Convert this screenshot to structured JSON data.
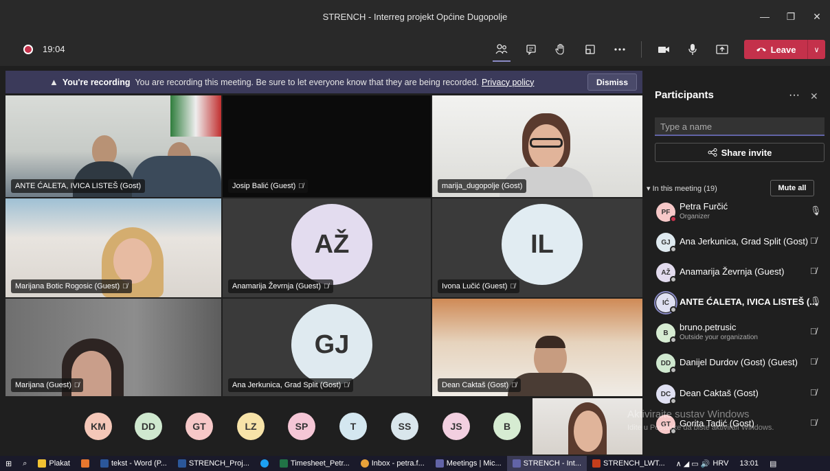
{
  "window": {
    "title": "STRENCH - Interreg projekt Općine Dugopolje",
    "min": "—",
    "max": "❐",
    "close": "✕"
  },
  "toolbar": {
    "timer": "19:04",
    "leave_label": "Leave"
  },
  "banner": {
    "title": "You're recording",
    "text": "You are recording this meeting. Be sure to let everyone know that they are being recorded.",
    "policy": "Privacy policy",
    "dismiss": "Dismiss"
  },
  "tiles": [
    {
      "name": "ANTE ĆALETA, IVICA LISTEŠ (Gost)",
      "muted": false
    },
    {
      "name": "Josip Balić (Guest)",
      "muted": true
    },
    {
      "name": "marija_dugopolje (Gost)",
      "muted": false
    },
    {
      "name": "Marijana Botic Rogosic (Guest)",
      "muted": true
    },
    {
      "name": "Anamarija Ževrnja (Guest)",
      "muted": true,
      "initials": "AŽ",
      "color": "#e3dcef"
    },
    {
      "name": "Ivona Lučić (Guest)",
      "muted": true,
      "initials": "IL",
      "color": "#e1ecf2"
    },
    {
      "name": "Marijana (Guest)",
      "muted": true
    },
    {
      "name": "Ana Jerkunica, Grad Split (Gost)",
      "muted": true,
      "initials": "GJ",
      "color": "#dfeaf0"
    },
    {
      "name": "Dean Caktaš (Gost)",
      "muted": true
    }
  ],
  "gallery": [
    {
      "initials": "KM",
      "color": "#f4c7b8"
    },
    {
      "initials": "DD",
      "color": "#cfe8cf"
    },
    {
      "initials": "GT",
      "color": "#f6c8c8"
    },
    {
      "initials": "LZ",
      "color": "#f7e3a8"
    },
    {
      "initials": "SP",
      "color": "#f5c6d6"
    },
    {
      "initials": "T",
      "color": "#d4e7f0"
    },
    {
      "initials": "SS",
      "color": "#d9e6ec"
    },
    {
      "initials": "JS",
      "color": "#f2cfe0"
    },
    {
      "initials": "B",
      "color": "#d6ecd2"
    }
  ],
  "panel": {
    "title": "Participants",
    "more": "···",
    "close": "✕",
    "search_placeholder": "Type a name",
    "share": "Share invite",
    "meeting_header": "In this meeting (19)",
    "mute_all": "Mute all",
    "participants": [
      {
        "initials": "PF",
        "name": "Petra Furčić",
        "sub": "Organizer",
        "color": "#f6c8c8",
        "mic": "on"
      },
      {
        "initials": "GJ",
        "name": "Ana Jerkunica, Grad Split (Gost)",
        "sub": "",
        "color": "#dfeaf0",
        "mic": "muted"
      },
      {
        "initials": "AŽ",
        "name": "Anamarija Ževrnja (Guest)",
        "sub": "",
        "color": "#e3dcef",
        "mic": "muted"
      },
      {
        "initials": "IĆ",
        "name": "ANTE ĆALETA, IVICA LISTEŠ (...",
        "sub": "",
        "color": "#dfe0f2",
        "mic": "on"
      },
      {
        "initials": "B",
        "name": "bruno.petrusic",
        "sub": "Outside your organization",
        "color": "#d6ecd2",
        "mic": "muted"
      },
      {
        "initials": "DD",
        "name": "Danijel Durdov (Gost) (Guest)",
        "sub": "",
        "color": "#cfe8cf",
        "mic": "muted"
      },
      {
        "initials": "DC",
        "name": "Dean Caktaš (Gost)",
        "sub": "",
        "color": "#dfe0f2",
        "mic": "muted"
      },
      {
        "initials": "GT",
        "name": "Gorita Tadić (Gost)",
        "sub": "",
        "color": "#f6c8c8",
        "mic": "muted"
      }
    ]
  },
  "watermark": {
    "line1": "Aktiviraite sustav Windows",
    "line2": "Idite u Postavke da biste aktivirali Windows."
  },
  "taskbar": {
    "items": [
      "Plakat",
      "tekst - Word (P...",
      "STRENCH_Proj...",
      "Timesheet_Petr...",
      "Inbox - petra.f...",
      "Meetings | Mic...",
      "STRENCH - Int...",
      "STRENCH_LWT..."
    ],
    "lang": "HRV",
    "time": "13:01"
  }
}
